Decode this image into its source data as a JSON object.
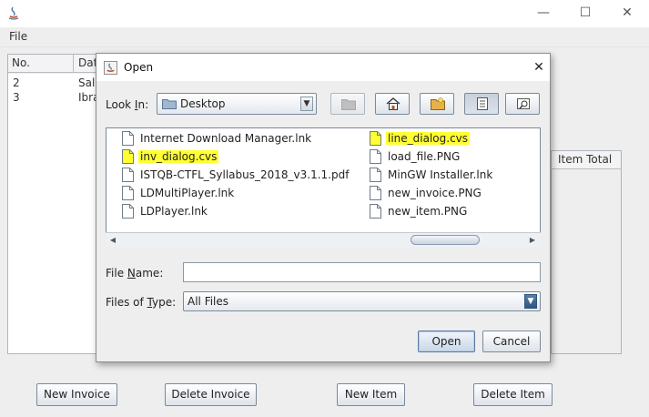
{
  "main_window": {
    "menu": {
      "file_label": "File"
    },
    "invoices_table": {
      "columns": [
        "No.",
        "Dat"
      ],
      "rows": [
        {
          "no": "2",
          "name": "Sal"
        },
        {
          "no": "3",
          "name": "Ibra"
        }
      ]
    },
    "lines_table": {
      "visible_column": "Item Total"
    },
    "buttons": {
      "new_invoice": "New Invoice",
      "delete_invoice": "Delete Invoice",
      "new_item": "New Item",
      "delete_item": "Delete Item"
    }
  },
  "dialog": {
    "title": "Open",
    "look_in": {
      "label_pre": "Look ",
      "label_mnemonic": "I",
      "label_post": "n:",
      "value": "Desktop"
    },
    "files": [
      {
        "name": "Internet Download Manager.lnk",
        "highlight": false
      },
      {
        "name": "inv_dialog.cvs",
        "highlight": true
      },
      {
        "name": "ISTQB-CTFL_Syllabus_2018_v3.1.1.pdf",
        "highlight": false
      },
      {
        "name": "LDMultiPlayer.lnk",
        "highlight": false
      },
      {
        "name": "LDPlayer.lnk",
        "highlight": false
      },
      {
        "name": "line_dialog.cvs",
        "highlight": true
      },
      {
        "name": "load_file.PNG",
        "highlight": false
      },
      {
        "name": "MinGW Installer.lnk",
        "highlight": false
      },
      {
        "name": "new_invoice.PNG",
        "highlight": false
      },
      {
        "name": "new_item.PNG",
        "highlight": false
      }
    ],
    "file_name": {
      "label_pre": "File ",
      "label_mnemonic": "N",
      "label_post": "ame:",
      "value": ""
    },
    "file_type": {
      "label_pre": "Files of ",
      "label_mnemonic": "T",
      "label_post": "ype:",
      "value": "All Files"
    },
    "open_label": "Open",
    "cancel_label": "Cancel"
  },
  "colors": {
    "highlight": "#ffff33",
    "window_bg": "#eeeeee",
    "border": "#7a8a99"
  },
  "icons": [
    "java-icon",
    "folder-icon",
    "up-folder-icon",
    "home-icon",
    "new-folder-icon",
    "list-view-icon",
    "details-view-icon",
    "file-icon"
  ]
}
